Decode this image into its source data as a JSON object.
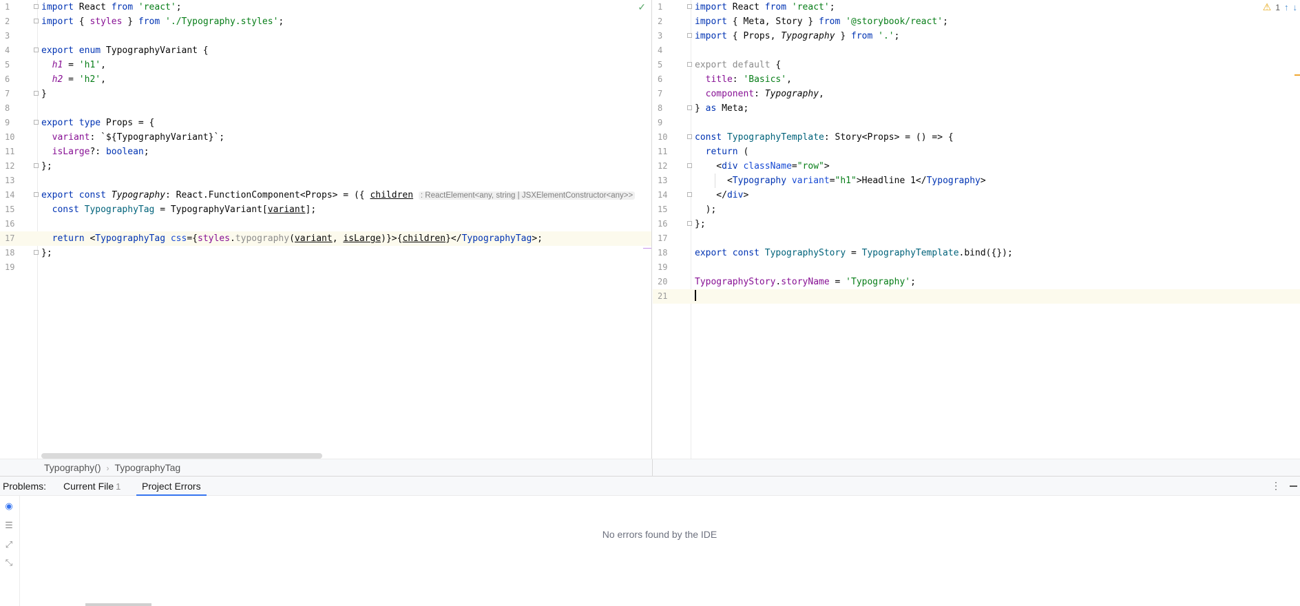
{
  "left_editor": {
    "lines": [
      {
        "n": "1",
        "html": "<span class='kw'>import</span> React <span class='kw'>from</span> <span class='str'>'react'</span>;"
      },
      {
        "n": "2",
        "html": "<span class='kw'>import</span> { <span class='fld'>styles</span> } <span class='kw'>from</span> <span class='str'>'./Typography.styles'</span>;"
      },
      {
        "n": "3",
        "html": ""
      },
      {
        "n": "4",
        "html": "<span class='kw'>export enum</span> TypographyVariant {"
      },
      {
        "n": "5",
        "html": "  <span class='fld-i'>h1</span> = <span class='str'>'h1'</span>,"
      },
      {
        "n": "6",
        "html": "  <span class='fld-i'>h2</span> = <span class='str'>'h2'</span>,"
      },
      {
        "n": "7",
        "html": "}"
      },
      {
        "n": "8",
        "html": ""
      },
      {
        "n": "9",
        "html": "<span class='kw'>export type</span> Props = {"
      },
      {
        "n": "10",
        "html": "  <span class='fld'>variant</span>: `${TypographyVariant}`;"
      },
      {
        "n": "11",
        "html": "  <span class='fld'>isLarge</span>?: <span class='kw'>boolean</span>;"
      },
      {
        "n": "12",
        "html": "};"
      },
      {
        "n": "13",
        "html": ""
      },
      {
        "n": "14",
        "html": "<span class='kw'>export const</span> <span class='ital'>Typography</span>: React.FunctionComponent&lt;Props&gt; = ({ <span class='uline'>children</span> <span class='hint'>: ReactElement&lt;any, string | JSXElementConstructor&lt;any&gt;&gt;</span>"
      },
      {
        "n": "15",
        "html": "  <span class='kw'>const</span> <span class='cst'>TypographyTag</span> = TypographyVariant[<span class='uline'>variant</span>];"
      },
      {
        "n": "16",
        "html": ""
      },
      {
        "n": "17",
        "html": "  <span class='kw'>return</span> &lt;<span class='tag'>TypographyTag</span> <span class='attr'>css</span>={<span class='fld'>styles</span>.<span class='fn-dim'>typography</span>(<span class='uline'>variant</span>, <span class='uline'>isLarge</span>)}&gt;{<span class='uline'>children</span>}&lt;/<span class='tag'>TypographyTag</span>&gt;;",
        "current": true
      },
      {
        "n": "18",
        "html": "};"
      },
      {
        "n": "19",
        "html": ""
      }
    ]
  },
  "right_editor": {
    "problem_count": "1",
    "lines": [
      {
        "n": "1",
        "html": "<span class='kw'>import</span> React <span class='kw'>from</span> <span class='str'>'react'</span>;"
      },
      {
        "n": "2",
        "html": "<span class='kw'>import</span> { Meta, Story } <span class='kw'>from</span> <span class='str'>'@storybook/react'</span>;"
      },
      {
        "n": "3",
        "html": "<span class='kw'>import</span> { Props, <span class='ital'>Typography</span> } <span class='kw'>from</span> <span class='str'>'.'</span>;"
      },
      {
        "n": "4",
        "html": ""
      },
      {
        "n": "5",
        "html": "<span class='muted'>export default</span> {"
      },
      {
        "n": "6",
        "html": "  <span class='fld'>title</span>: <span class='str'>'Basics'</span>,"
      },
      {
        "n": "7",
        "html": "  <span class='fld'>component</span>: <span class='ital'>Typography</span>,"
      },
      {
        "n": "8",
        "html": "} <span class='kw'>as</span> Meta;"
      },
      {
        "n": "9",
        "html": ""
      },
      {
        "n": "10",
        "html": "<span class='kw'>const</span> <span class='cst'>TypographyTemplate</span>: Story&lt;Props&gt; = () =&gt; {"
      },
      {
        "n": "11",
        "html": "  <span class='kw'>return</span> ("
      },
      {
        "n": "12",
        "html": "    &lt;<span class='tag'>div</span> <span class='attr'>className</span>=<span class='str'>\"row\"</span>&gt;"
      },
      {
        "n": "13",
        "html": "      &lt;<span class='tag'>Typography</span> <span class='attr'>variant</span>=<span class='str'>\"h1\"</span>&gt;Headline 1&lt;/<span class='tag'>Typography</span>&gt;"
      },
      {
        "n": "14",
        "html": "    &lt;/<span class='tag'>div</span>&gt;"
      },
      {
        "n": "15",
        "html": "  );"
      },
      {
        "n": "16",
        "html": "};"
      },
      {
        "n": "17",
        "html": ""
      },
      {
        "n": "18",
        "html": "<span class='kw'>export const</span> <span class='cst'>TypographyStory</span> = <span class='cst'>TypographyTemplate</span>.bind({});"
      },
      {
        "n": "19",
        "html": ""
      },
      {
        "n": "20",
        "html": "<span class='fld'>TypographyStory</span>.<span class='fld'>storyName</span> = <span class='str'>'Typography'</span>;"
      },
      {
        "n": "21",
        "html": "<span class='cursor'></span>",
        "current": true
      }
    ]
  },
  "breadcrumb": {
    "items": [
      "Typography()",
      "TypographyTag"
    ],
    "separator": "›"
  },
  "problems": {
    "title": "Problems:",
    "tabs": [
      {
        "label": "Current File",
        "count": "1"
      },
      {
        "label": "Project Errors",
        "count": ""
      }
    ],
    "empty_message": "No errors found by the IDE"
  },
  "icons": {
    "check": "check-icon",
    "warning": "warning-icon",
    "more": "more-vertical-icon"
  },
  "colors": {
    "keyword": "#0033b3",
    "string": "#067d17",
    "field": "#871094",
    "constant": "#00627a",
    "accent": "#3574f0",
    "current_line": "#fcfaed"
  }
}
